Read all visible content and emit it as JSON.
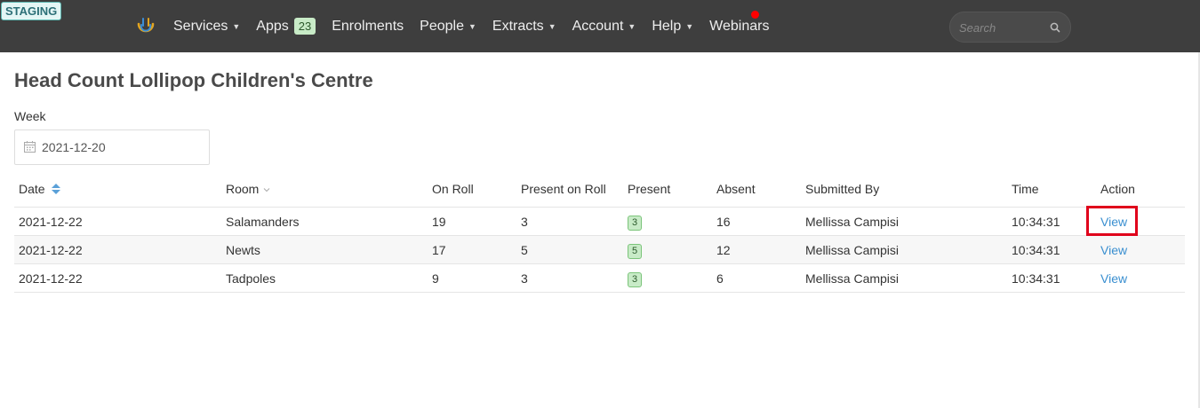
{
  "env_badge": "STAGING",
  "nav": {
    "services": "Services",
    "apps": "Apps",
    "apps_count": "23",
    "enrolments": "Enrolments",
    "people": "People",
    "extracts": "Extracts",
    "account": "Account",
    "help": "Help",
    "webinars": "Webinars",
    "caret": "▼"
  },
  "search": {
    "placeholder": "Search"
  },
  "page": {
    "title": "Head Count Lollipop Children's Centre",
    "week_label": "Week",
    "week_value": "2021-12-20"
  },
  "table": {
    "headers": {
      "date": "Date",
      "room": "Room",
      "on_roll": "On Roll",
      "present_on_roll": "Present on Roll",
      "present": "Present",
      "absent": "Absent",
      "submitted_by": "Submitted By",
      "time": "Time",
      "action": "Action"
    },
    "rows": [
      {
        "date": "2021-12-22",
        "room": "Salamanders",
        "on_roll": "19",
        "present_on_roll": "3",
        "present": "3",
        "absent": "16",
        "submitted_by": "Mellissa Campisi",
        "time": "10:34:31",
        "action": "View"
      },
      {
        "date": "2021-12-22",
        "room": "Newts",
        "on_roll": "17",
        "present_on_roll": "5",
        "present": "5",
        "absent": "12",
        "submitted_by": "Mellissa Campisi",
        "time": "10:34:31",
        "action": "View"
      },
      {
        "date": "2021-12-22",
        "room": "Tadpoles",
        "on_roll": "9",
        "present_on_roll": "3",
        "present": "3",
        "absent": "6",
        "submitted_by": "Mellissa Campisi",
        "time": "10:34:31",
        "action": "View"
      }
    ]
  },
  "icons": {
    "logo": "logo-icon",
    "search": "search-icon",
    "calendar": "calendar-icon",
    "sort_both": "sort-icon",
    "sort_down": "sort-down-icon"
  },
  "colors": {
    "navbar": "#3e3e3e",
    "link": "#3a8fd0",
    "badge_green": "#c8ebc7",
    "highlight": "#e0001b",
    "notification": "#ff0000"
  }
}
